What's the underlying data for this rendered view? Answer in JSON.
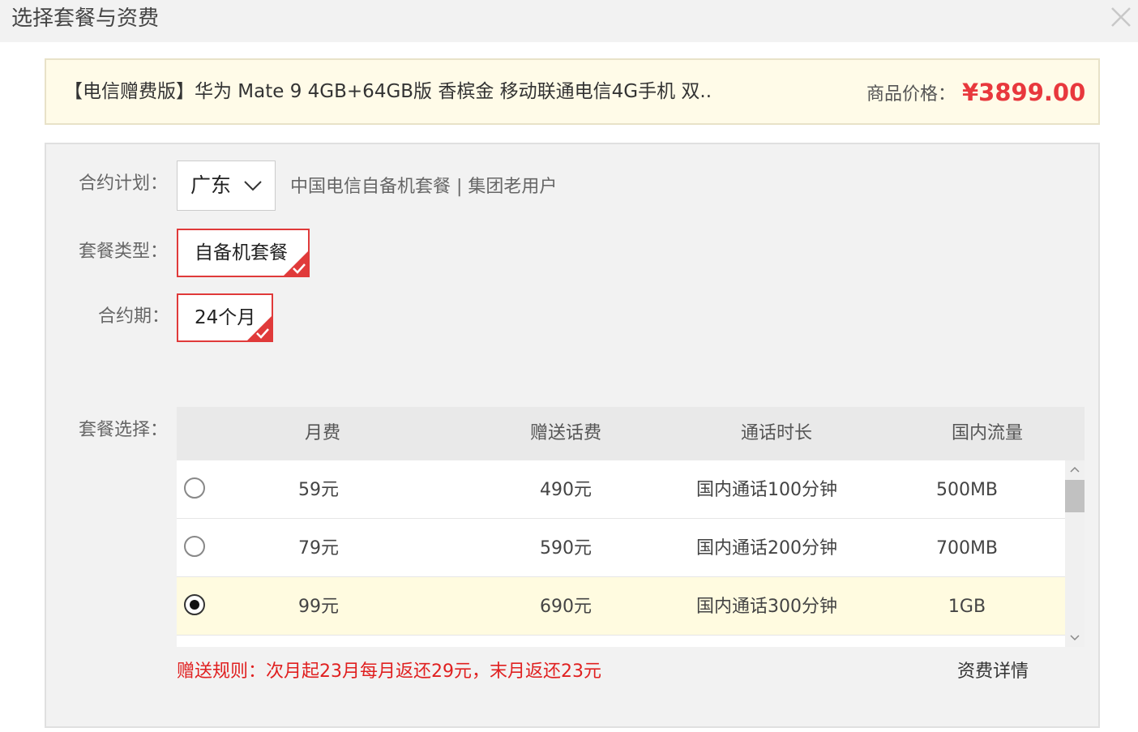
{
  "dialog": {
    "title": "选择套餐与资费"
  },
  "product": {
    "name": "【电信赠费版】华为 Mate 9 4GB+64GB版 香槟金 移动联通电信4G手机 双..",
    "price_label": "商品价格：",
    "price": "¥3899.00"
  },
  "form": {
    "plan_label": "合约计划：",
    "region": "广东",
    "plan_desc": "中国电信自备机套餐 | 集团老用户",
    "type_label": "套餐类型：",
    "type_option": "自备机套餐",
    "term_label": "合约期：",
    "term_option": "24个月",
    "package_label": "套餐选择："
  },
  "table": {
    "headers": [
      "月费",
      "赠送话费",
      "通话时长",
      "国内流量"
    ],
    "rows": [
      {
        "fee": "59元",
        "bonus": "490元",
        "minutes": "国内通话100分钟",
        "data": "500MB",
        "selected": false
      },
      {
        "fee": "79元",
        "bonus": "590元",
        "minutes": "国内通话200分钟",
        "data": "700MB",
        "selected": false
      },
      {
        "fee": "99元",
        "bonus": "690元",
        "minutes": "国内通话300分钟",
        "data": "1GB",
        "selected": true
      }
    ]
  },
  "footer": {
    "rule": "赠送规则：次月起23月每月返还29元，末月返还23元",
    "details_link": "资费详情"
  },
  "colors": {
    "accent": "#e03a3a",
    "price": "#e8383d",
    "selected_row": "#fffbe0",
    "product_bg": "#fffbe8"
  },
  "icons": {
    "close": "close-icon",
    "dropdown": "chevron-down-icon",
    "check": "check-icon",
    "scroll_up": "chevron-up-icon",
    "scroll_down": "chevron-down-icon"
  }
}
